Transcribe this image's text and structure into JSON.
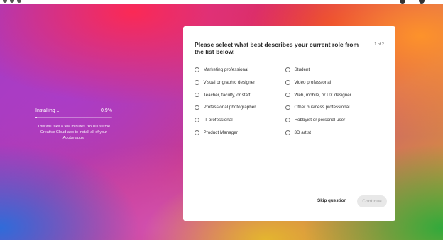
{
  "installer": {
    "label": "Installing ...",
    "percent_text": "0.9%",
    "progress": 0.009,
    "description": "This will take a few minutes. You'll use the Creative Cloud app to install all of your Adobe apps."
  },
  "survey": {
    "title": "Please select what best describes your current role from the list below.",
    "step": "1 of 2",
    "options": [
      {
        "label": "Marketing professional"
      },
      {
        "label": "Student"
      },
      {
        "label": "Visual or graphic designer"
      },
      {
        "label": "Video professional"
      },
      {
        "label": "Teacher, faculty, or staff"
      },
      {
        "label": "Web, mobile, or UX designer"
      },
      {
        "label": "Professional photographer"
      },
      {
        "label": "Other business professional"
      },
      {
        "label": "IT professional"
      },
      {
        "label": "Hobbyist or personal user"
      },
      {
        "label": "Product Manager"
      },
      {
        "label": "3D artist"
      }
    ],
    "skip_label": "Skip question",
    "continue_label": "Continue"
  }
}
